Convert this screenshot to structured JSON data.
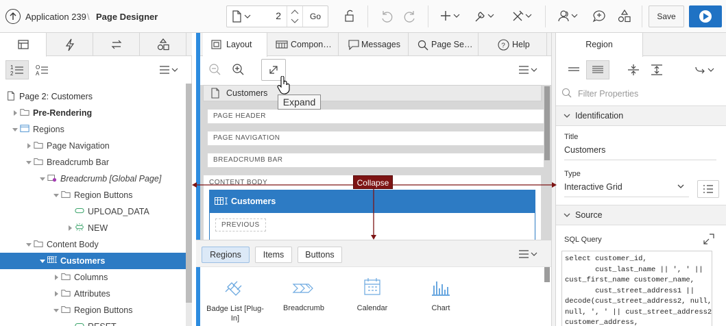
{
  "header": {
    "app_label": "Application 239",
    "crumb_sep": "\\",
    "page_designer_label": "Page Designer",
    "page_number": "2",
    "go_label": "Go",
    "save_label": "Save"
  },
  "left_pane": {
    "tabs": [
      {
        "icon": "rendering-icon"
      },
      {
        "icon": "lightning-icon"
      },
      {
        "icon": "processing-icon"
      },
      {
        "icon": "shared-components-icon"
      }
    ],
    "tree": [
      {
        "label": "Page 2: Customers",
        "level": 0,
        "icon": "page"
      },
      {
        "label": "Pre-Rendering",
        "level": 1,
        "icon": "folder",
        "bold": true
      },
      {
        "label": "Regions",
        "level": 1,
        "icon": "region"
      },
      {
        "label": "Page Navigation",
        "level": 2,
        "icon": "folder"
      },
      {
        "label": "Breadcrumb Bar",
        "level": 2,
        "icon": "folder"
      },
      {
        "label": "Breadcrumb [Global Page]",
        "level": 3,
        "icon": "breadcrumb",
        "italic": true
      },
      {
        "label": "Region Buttons",
        "level": 4,
        "icon": "folder"
      },
      {
        "label": "UPLOAD_DATA",
        "level": 5,
        "icon": "button"
      },
      {
        "label": "NEW",
        "level": 5,
        "icon": "button-new"
      },
      {
        "label": "Content Body",
        "level": 2,
        "icon": "folder"
      },
      {
        "label": "Customers",
        "level": 3,
        "icon": "grid",
        "selected": true
      },
      {
        "label": "Columns",
        "level": 4,
        "icon": "folder"
      },
      {
        "label": "Attributes",
        "level": 4,
        "icon": "folder"
      },
      {
        "label": "Region Buttons",
        "level": 4,
        "icon": "folder"
      },
      {
        "label": "RESET",
        "level": 5,
        "icon": "button"
      }
    ]
  },
  "center": {
    "tabs": {
      "layout": "Layout",
      "components": "Compon…",
      "messages": "Messages",
      "page_search": "Page Se…",
      "help": "Help"
    },
    "layout": {
      "region_title": "Customers",
      "bars": [
        "PAGE HEADER",
        "PAGE NAVIGATION",
        "BREADCRUMB BAR",
        "CONTENT BODY"
      ],
      "grid_region": "Customers",
      "previous_button": "PREVIOUS"
    },
    "gallery": {
      "tabs": [
        "Regions",
        "Items",
        "Buttons"
      ],
      "items": [
        {
          "label": "Badge List [Plug-In]",
          "icon": "plug-icon"
        },
        {
          "label": "Breadcrumb",
          "icon": "breadcrumb-icon"
        },
        {
          "label": "Calendar",
          "icon": "calendar-icon"
        },
        {
          "label": "Chart",
          "icon": "chart-icon"
        }
      ]
    }
  },
  "right_pane": {
    "tab_label": "Region",
    "filter_placeholder": "Filter Properties",
    "identification": {
      "heading": "Identification",
      "title_label": "Title",
      "title_value": "Customers",
      "type_label": "Type",
      "type_value": "Interactive Grid"
    },
    "source": {
      "heading": "Source",
      "sql_label": "SQL Query",
      "sql_query": "select customer_id,\n       cust_last_name || ', ' ||\ncust_first_name customer_name,\n       cust_street_address1 ||\ndecode(cust_street_address2, null,\nnull, ', ' || cust_street_address2)\ncustomer_address,"
    }
  },
  "overlays": {
    "tooltip": "Expand",
    "collapse": "Collapse"
  },
  "colors": {
    "accent_blue": "#2d7bc4",
    "run_button": "#1f72c4",
    "collapse_marker": "#7d1414",
    "splitter": "#2d8cdf"
  }
}
